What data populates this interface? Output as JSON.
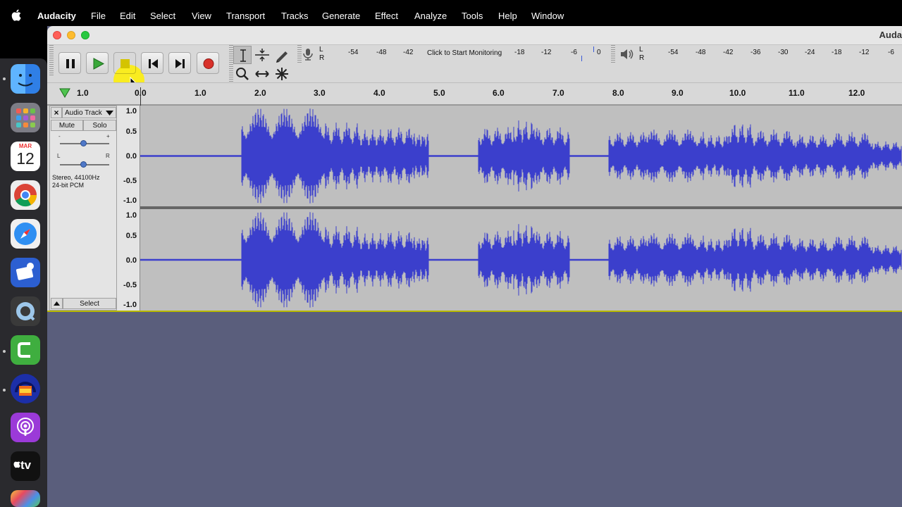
{
  "menubar": {
    "app_name": "Audacity",
    "items": [
      "File",
      "Edit",
      "Select",
      "View",
      "Transport",
      "Tracks",
      "Generate",
      "Effect",
      "Analyze",
      "Tools",
      "Help",
      "Window"
    ]
  },
  "dock": {
    "items": [
      {
        "name": "finder",
        "color": "#3d8ff0"
      },
      {
        "name": "launchpad",
        "color": "#8a8a8a"
      },
      {
        "name": "calendar",
        "month": "MAR",
        "day": "12"
      },
      {
        "name": "chrome",
        "color": "#e8e8e8"
      },
      {
        "name": "safari",
        "color": "#2f8ff2"
      },
      {
        "name": "screen-recorder",
        "color": "#2c5fd1"
      },
      {
        "name": "quicktime",
        "color": "#3a3a3a"
      },
      {
        "name": "camtasia",
        "color": "#3fae3f"
      },
      {
        "name": "audacity",
        "color": "#1c2fa8"
      },
      {
        "name": "podcasts",
        "color": "#9b3ad8"
      },
      {
        "name": "apple-tv",
        "label": "tv",
        "color": "#111111"
      },
      {
        "name": "photos",
        "color": "#dddddd"
      }
    ]
  },
  "window": {
    "title": "Auda"
  },
  "meters": {
    "record_lr": [
      "L",
      "R"
    ],
    "record_ticks": [
      "-54",
      "-48",
      "-42",
      "-18",
      "-12",
      "-6",
      "0"
    ],
    "monitor_label": "Click to Start Monitoring",
    "play_lr": [
      "L",
      "R"
    ],
    "play_ticks": [
      "-54",
      "-48",
      "-42",
      "-36",
      "-30",
      "-24",
      "-18",
      "-12",
      "-6"
    ]
  },
  "ruler": {
    "ticks": [
      "1.0",
      "0.0",
      "1.0",
      "2.0",
      "3.0",
      "4.0",
      "5.0",
      "6.0",
      "7.0",
      "8.0",
      "9.0",
      "10.0",
      "11.0",
      "12.0"
    ]
  },
  "track": {
    "name": "Audio Track",
    "mute": "Mute",
    "solo": "Solo",
    "gain_minus": "-",
    "gain_plus": "+",
    "pan_left": "L",
    "pan_right": "R",
    "info_line1": "Stereo, 44100Hz",
    "info_line2": "24-bit PCM",
    "select": "Select",
    "close": "×",
    "vscale": [
      "1.0",
      "0.5",
      "0.0",
      "-0.5",
      "-1.0"
    ]
  },
  "colors": {
    "waveform": "#3b3fcc",
    "waveform_bg": "#bfbfbf",
    "record_button": "#d8312a",
    "play_button": "#3aa83a",
    "highlight": "#fff000"
  }
}
